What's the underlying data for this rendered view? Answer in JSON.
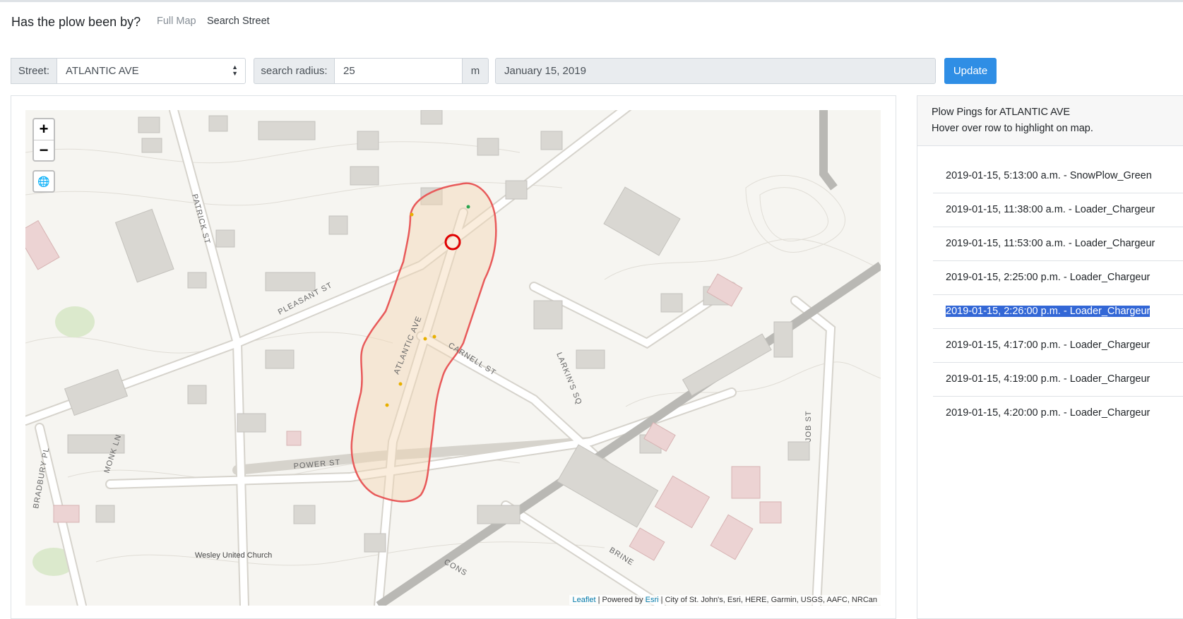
{
  "app": {
    "brand": "Has the plow been by?",
    "nav": {
      "full_map": "Full Map",
      "search_street": "Search Street"
    }
  },
  "form": {
    "street_label": "Street:",
    "street_value": "ATLANTIC AVE",
    "radius_label": "search radius:",
    "radius_value": "25",
    "radius_unit": "m",
    "date_value": "January 15, 2019",
    "update_label": "Update"
  },
  "map": {
    "zoom_in": "+",
    "zoom_out": "−",
    "locate_icon": "globe-icon",
    "attribution": {
      "leaflet": "Leaflet",
      "powered_by": " | Powered by ",
      "esri": "Esri",
      "sources": " | City of St. John's, Esri, HERE, Garmin, USGS, AAFC, NRCan"
    },
    "streets": {
      "pleasant": "PLEASANT ST",
      "atlantic": "ATLANTIC AVE",
      "carnell": "CARNELL ST",
      "power": "POWER ST",
      "patrick": "PATRICK ST",
      "larkins": "LARKIN'S SQ",
      "monk": "MONK LN",
      "bradbury": "BRADBURY PL",
      "job": "JOB ST",
      "brine": "BRINE",
      "cons": "CONS"
    },
    "church": "Wesley United Church",
    "buffer_color": "#e85a5a",
    "highlight_color": "#e00000"
  },
  "panel": {
    "title": "Plow Pings for ATLANTIC AVE",
    "subtitle": "Hover over row to highlight on map.",
    "pings": [
      "2019-01-15, 5:13:00 a.m. - SnowPlow_Green",
      "2019-01-15, 11:38:00 a.m. - Loader_Chargeur",
      "2019-01-15, 11:53:00 a.m. - Loader_Chargeur",
      "2019-01-15, 2:25:00 p.m. - Loader_Chargeur",
      "2019-01-15, 2:26:00 p.m. - Loader_Chargeur",
      "2019-01-15, 4:17:00 p.m. - Loader_Chargeur",
      "2019-01-15, 4:19:00 p.m. - Loader_Chargeur",
      "2019-01-15, 4:20:00 p.m. - Loader_Chargeur"
    ],
    "selected_index": 4
  }
}
